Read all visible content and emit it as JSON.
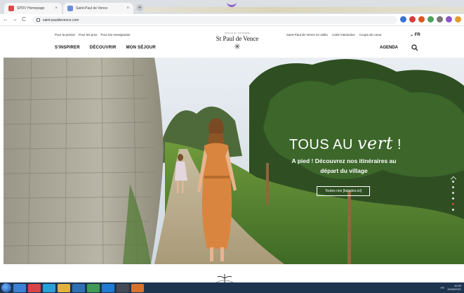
{
  "browser": {
    "tabs": [
      {
        "title": "SPDV Homepage",
        "close": "×"
      },
      {
        "title": "Saint-Paul de Vence",
        "close": "×"
      }
    ],
    "new_tab": "+",
    "nav": {
      "back": "←",
      "forward": "→",
      "reload": "C"
    },
    "url": "saint-pauldevence.com"
  },
  "header": {
    "top_links": [
      "Pour la presse",
      "Pour les pros",
      "Pour les enseignants"
    ],
    "main_nav": [
      "S'INSPIRER",
      "DÉCOUVRIR",
      "MON SÉJOUR"
    ],
    "logo": {
      "small": "OFFICE DU TOURISME",
      "name": "St Paul de Vence",
      "star": "✳"
    },
    "right_links": [
      "Saint-Paul de Vence en vidéo",
      "Carte interactive",
      "Coups de coeur"
    ],
    "language": "FR",
    "language_chevron": "⌄",
    "agenda": "AGENDA"
  },
  "hero": {
    "title": "TOUS AU",
    "title_script": "vert",
    "title_end": "!",
    "subtitle_line1": "A pied ! Découvrez nos itinéraires au",
    "subtitle_line2": "départ du village",
    "button": "Toutes nos [balades.ici]"
  },
  "taskbar": {
    "clock_time": "10:05",
    "clock_date": "15/06/2021",
    "lang": "FR"
  },
  "colors": {
    "accent_red": "#e44",
    "nav_text": "#111",
    "taskbar": "#1e3550"
  }
}
